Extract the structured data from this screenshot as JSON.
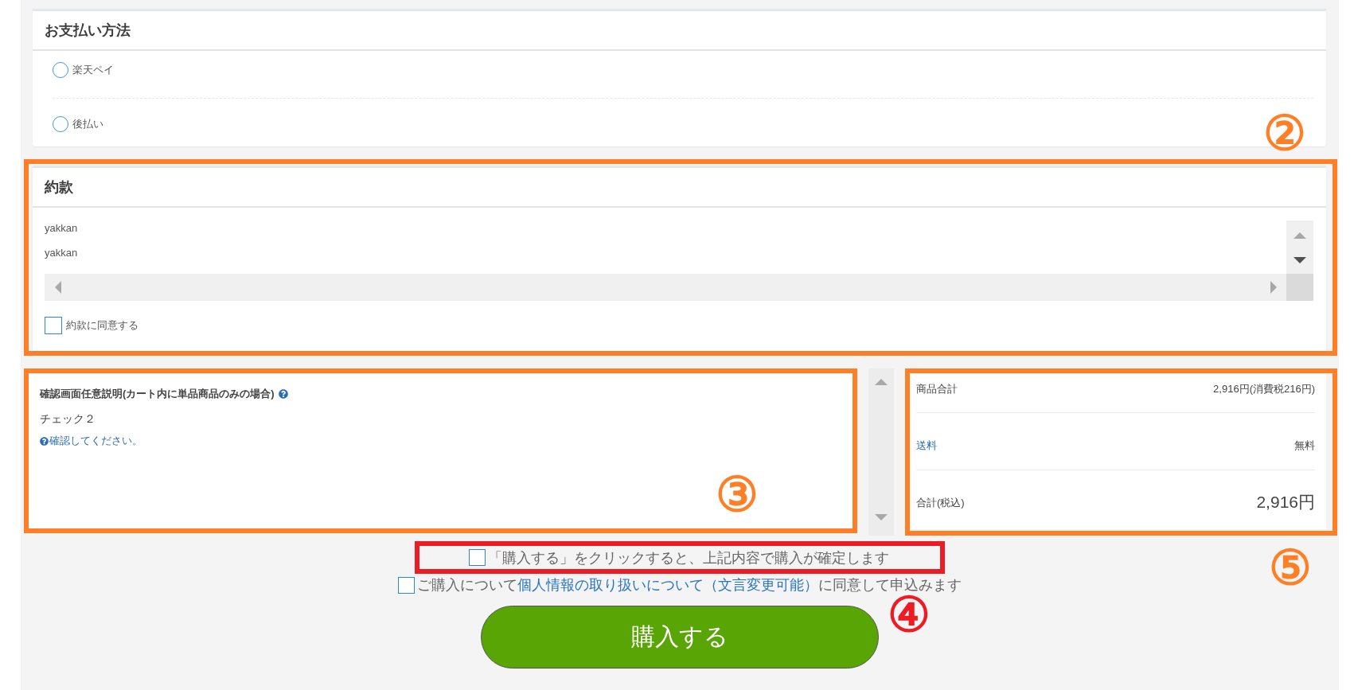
{
  "payment_method": {
    "title": "お支払い方法",
    "options": [
      {
        "label": "楽天ペイ",
        "selected": false
      },
      {
        "label": "後払い",
        "selected": false
      }
    ]
  },
  "terms": {
    "title": "約款",
    "lines": [
      "yakkan",
      "yakkan"
    ],
    "agree": {
      "label": "約款に同意する",
      "checked": false
    }
  },
  "confirmation_note": {
    "title": "確認画面任意説明(カート内に単品商品のみの場合)",
    "value": "チェック２",
    "link": "確認してください。"
  },
  "summary": {
    "rows": [
      {
        "kind": "plain",
        "label": "商品合計",
        "value": "2,916円(消費税216円)"
      },
      {
        "kind": "link",
        "label": "送料",
        "value": "無料"
      },
      {
        "kind": "total",
        "label": "合計(税込)",
        "value": "2,916円"
      }
    ]
  },
  "agreements": [
    {
      "kind": "plain",
      "text": "「購入する」をクリックすると、上記内容で購入が確定します",
      "checked": false
    },
    {
      "kind": "link",
      "before": "ご購入について",
      "link": "個人情報の取り扱いについて（文言変更可能）",
      "after": "に同意して申込みます",
      "checked": false
    }
  ],
  "purchase_button": "購入する",
  "annotations": [
    {
      "label": "②",
      "color": "#ff7f27"
    },
    {
      "label": "③",
      "color": "#ff7f27"
    },
    {
      "label": "⑤",
      "color": "#ff7f27"
    },
    {
      "label": "④",
      "color": "#ed1c24"
    }
  ]
}
